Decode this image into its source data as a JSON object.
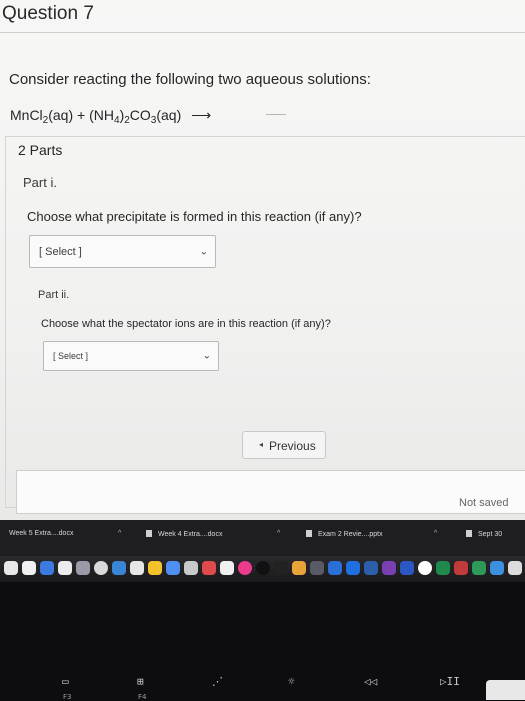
{
  "question": {
    "title": "Question 7",
    "prompt": "Consider reacting the following two aqueous solutions:",
    "equation": {
      "r1_a": "MnCl",
      "r1_b": "2",
      "r1_c": "(aq)",
      "plus": "+",
      "r2_a": "(NH",
      "r2_b": "4",
      "r2_c": ")",
      "r2_d": "2",
      "r2_e": "CO",
      "r2_f": "3",
      "r2_g": "(aq)",
      "arrow": "⟶"
    },
    "parts_count": "2 Parts"
  },
  "parts": [
    {
      "label": "Part i.",
      "question": "Choose what precipitate is formed in this reaction (if any)?",
      "select_value": "[ Select ]"
    },
    {
      "label": "Part ii.",
      "question": "Choose what the spectator ions are in this reaction (if any)?",
      "select_value": "[ Select ]"
    }
  ],
  "nav": {
    "previous_label": "Previous",
    "save_status": "Not saved"
  },
  "downloads": [
    {
      "name": "Week 5 Extra....docx"
    },
    {
      "name": "Week 4 Extra....docx"
    },
    {
      "name": "Exam 2 Revie....pptx"
    },
    {
      "name": "Sept 30"
    }
  ],
  "icons": {
    "chevron": "chevron-down-icon",
    "previous": "triangle-left-icon"
  },
  "colors": {
    "page_bg": "#f3f3f2",
    "border": "#cfcfcf",
    "text": "#262626",
    "downloads_bg": "#1e1e22"
  },
  "keyboard": {
    "f3_glyph": "▭",
    "f4_glyph": "⊞",
    "f5_glyph": "⋰",
    "f6_glyph": "☼",
    "f7_glyph": "◁◁",
    "f8_glyph": "▷II",
    "f3_num": "F3",
    "f4_num": "F4"
  }
}
